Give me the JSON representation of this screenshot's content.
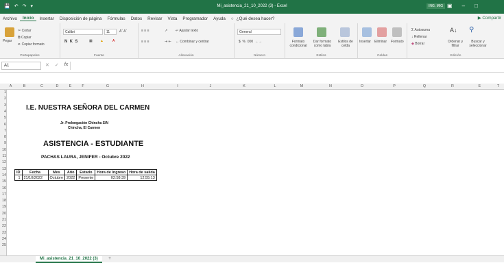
{
  "window": {
    "title": "Mi_asistencia_21_10_2022 (3) - Excel",
    "user": "ING. MIG"
  },
  "menu": {
    "tabs": [
      "Archivo",
      "Inicio",
      "Insertar",
      "Disposición de página",
      "Fórmulas",
      "Datos",
      "Revisar",
      "Vista",
      "Programador",
      "Ayuda"
    ],
    "tell": "¿Qué desea hacer?",
    "share": "Compartir"
  },
  "ribbon": {
    "clipboard": {
      "paste": "Pegar",
      "cut": "Cortar",
      "copy": "Copiar",
      "format_painter": "Copiar formato",
      "label": "Portapapeles"
    },
    "font": {
      "name": "Calibri",
      "size": "11",
      "label": "Fuente"
    },
    "alignment": {
      "wrap": "Ajustar texto",
      "merge": "Combinar y centrar",
      "label": "Alineación"
    },
    "number": {
      "format": "General",
      "label": "Número"
    },
    "styles": {
      "conditional": "Formato condicional",
      "table": "Dar formato como tabla",
      "cell": "Estilos de celda",
      "label": "Estilos"
    },
    "cells": {
      "insert": "Insertar",
      "delete": "Eliminar",
      "format": "Formato",
      "label": "Celdas"
    },
    "editing": {
      "autosum": "Autosuma",
      "fill": "Rellenar",
      "clear": "Borrar",
      "sort": "Ordenar y filtrar",
      "find": "Buscar y seleccionar",
      "label": "Edición"
    }
  },
  "formula": {
    "namebox": "A1",
    "fx": "fx",
    "value": ""
  },
  "columns": [
    "A",
    "B",
    "C",
    "D",
    "E",
    "F",
    "G",
    "H",
    "I",
    "J",
    "K",
    "L",
    "M",
    "N",
    "O",
    "P",
    "Q",
    "R",
    "S",
    "T"
  ],
  "rows": [
    "1",
    "2",
    "3",
    "4",
    "5",
    "6",
    "7",
    "8",
    "9",
    "10",
    "11",
    "12",
    "13",
    "14",
    "15",
    "16",
    "17",
    "18",
    "19",
    "20",
    "21",
    "22",
    "23",
    "24",
    "25"
  ],
  "sheet": {
    "school": "I.E. NUESTRA SEÑORA DEL CARMEN",
    "address1": "Jr. Prolongación Chincha S/N",
    "address2": "Chincha, El Carmen",
    "heading": "ASISTENCIA - ESTUDIANTE",
    "student": "PACHAS LAURA, JENIFER - Octubre 2022",
    "table": {
      "headers": [
        "ID",
        "Fecha",
        "Mes",
        "Año",
        "Estado",
        "Hora de Ingreso",
        "Hora de salida"
      ],
      "rows": [
        [
          "1",
          "21/10/2022",
          "Octubre",
          "2022",
          "Presente",
          "02:58:39",
          "12:55:13"
        ]
      ]
    }
  },
  "tabs": {
    "active": "Mi_asistencia_21_10_2022 (3)",
    "add": "+"
  },
  "colors": {
    "accent": "#217346"
  }
}
